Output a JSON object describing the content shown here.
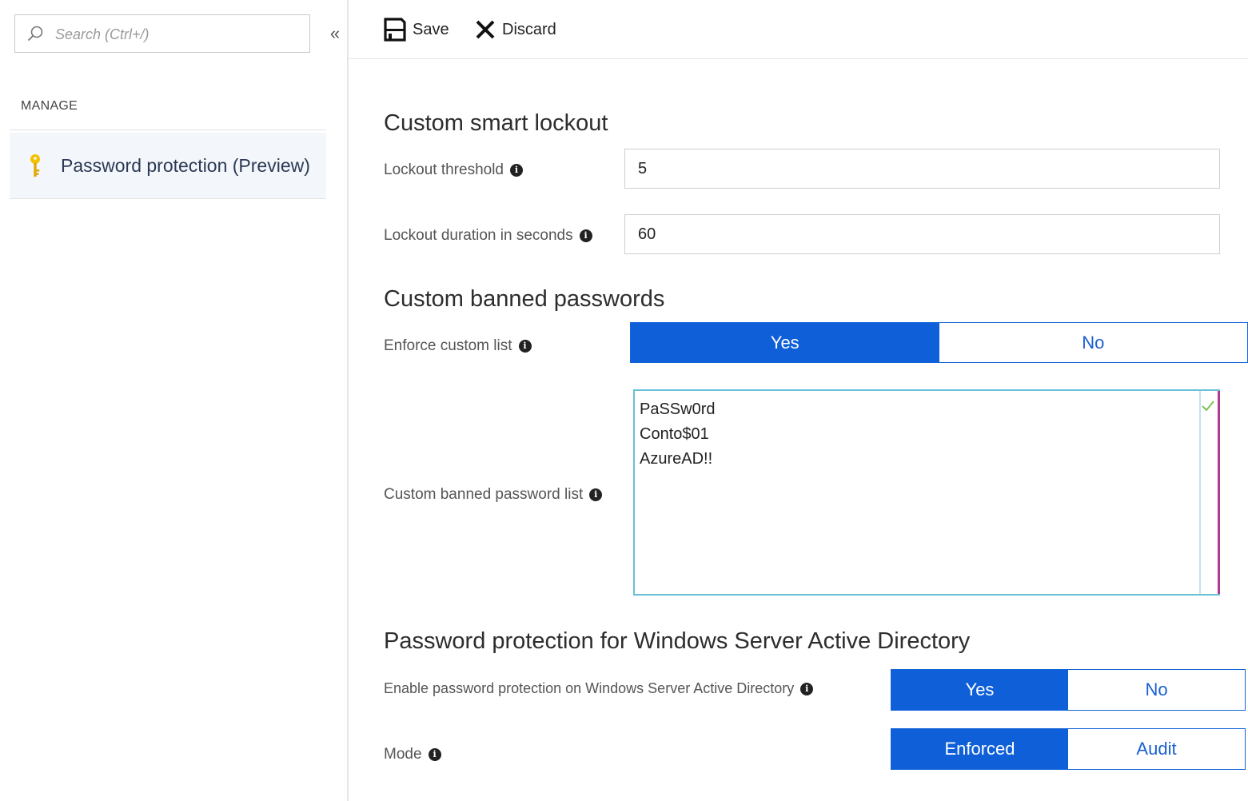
{
  "sidebar": {
    "search_placeholder": "Search (Ctrl+/)",
    "collapse_glyph": "«",
    "section_heading": "MANAGE",
    "items": [
      {
        "label": "Password protection (Preview)",
        "icon": "key-icon",
        "selected": true
      }
    ]
  },
  "toolbar": {
    "save_label": "Save",
    "discard_label": "Discard"
  },
  "smart_lockout": {
    "title": "Custom smart lockout",
    "threshold_label": "Lockout threshold",
    "threshold_value": "5",
    "duration_label": "Lockout duration in seconds",
    "duration_value": "60"
  },
  "banned_passwords": {
    "title": "Custom banned passwords",
    "enforce_label": "Enforce custom list",
    "enforce_options": {
      "yes": "Yes",
      "no": "No"
    },
    "enforce_selected": "Yes",
    "list_label": "Custom banned password list",
    "list_value": "PaSSw0rd\nConto$01\nAzureAD!!"
  },
  "windows_ad": {
    "title": "Password protection for Windows Server Active Directory",
    "enable_label": "Enable password protection on Windows Server Active Directory",
    "enable_options": {
      "yes": "Yes",
      "no": "No"
    },
    "enable_selected": "Yes",
    "mode_label": "Mode",
    "mode_options": {
      "enforced": "Enforced",
      "audit": "Audit"
    },
    "mode_selected": "Enforced"
  },
  "colors": {
    "accent": "#0e5fd8",
    "toggle_off_text": "#1a5fd0",
    "list_border": "#6cc0d8",
    "valid_check": "#6fbf4a",
    "key_icon": "#f2c200"
  }
}
